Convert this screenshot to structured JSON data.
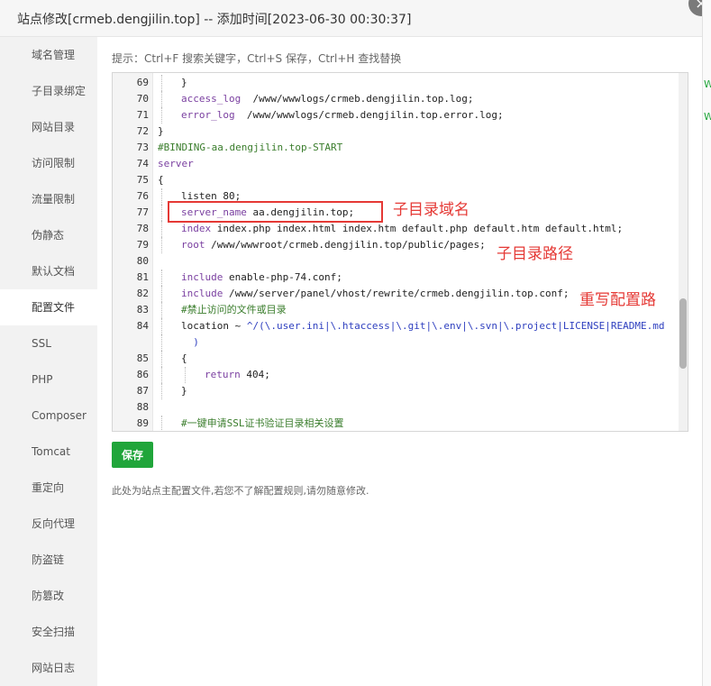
{
  "window": {
    "title": "站点修改[crmeb.dengjilin.top] -- 添加时间[2023-06-30 00:30:37]",
    "close_symbol": "×"
  },
  "sidebar": {
    "active_index": 7,
    "items": [
      "域名管理",
      "子目录绑定",
      "网站目录",
      "访问限制",
      "流量限制",
      "伪静态",
      "默认文档",
      "配置文件",
      "SSL",
      "PHP",
      "Composer",
      "Tomcat",
      "重定向",
      "反向代理",
      "防盗链",
      "防篡改",
      "安全扫描",
      "网站日志"
    ]
  },
  "hint": "提示：Ctrl+F 搜索关键字，Ctrl+S 保存，Ctrl+H 查找替换",
  "editor": {
    "lines": [
      {
        "ln": "69",
        "indent": 1,
        "segs": [
          {
            "t": "}",
            "c": "plain"
          }
        ]
      },
      {
        "ln": "70",
        "indent": 1,
        "segs": [
          {
            "t": "access_log",
            "c": "kw"
          },
          {
            "t": "  /www/wwwlogs/crmeb.dengjilin.top.log;",
            "c": "plain"
          }
        ]
      },
      {
        "ln": "71",
        "indent": 1,
        "segs": [
          {
            "t": "error_log",
            "c": "kw"
          },
          {
            "t": "  /www/wwwlogs/crmeb.dengjilin.top.error.log;",
            "c": "plain"
          }
        ]
      },
      {
        "ln": "72",
        "indent": 0,
        "segs": [
          {
            "t": "}",
            "c": "plain"
          }
        ]
      },
      {
        "ln": "73",
        "indent": 0,
        "segs": [
          {
            "t": "#BINDING-aa.dengjilin.top-START",
            "c": "green"
          }
        ]
      },
      {
        "ln": "74",
        "indent": 0,
        "segs": [
          {
            "t": "server",
            "c": "kw"
          }
        ]
      },
      {
        "ln": "75",
        "indent": 0,
        "segs": [
          {
            "t": "{",
            "c": "plain"
          }
        ]
      },
      {
        "ln": "76",
        "indent": 1,
        "segs": [
          {
            "t": "listen 80;",
            "c": "plain"
          }
        ]
      },
      {
        "ln": "77",
        "indent": 1,
        "segs": [
          {
            "t": "server_name",
            "c": "kw"
          },
          {
            "t": " aa.dengjilin.top;",
            "c": "plain"
          }
        ]
      },
      {
        "ln": "78",
        "indent": 1,
        "segs": [
          {
            "t": "index",
            "c": "kw"
          },
          {
            "t": " index.php index.html index.htm default.php default.htm default.html;",
            "c": "plain"
          }
        ]
      },
      {
        "ln": "79",
        "indent": 1,
        "segs": [
          {
            "t": "root",
            "c": "kw"
          },
          {
            "t": " /www/wwwroot/crmeb.dengjilin.top/public/pages;",
            "c": "plain"
          }
        ]
      },
      {
        "ln": "80",
        "indent": 0,
        "segs": []
      },
      {
        "ln": "81",
        "indent": 1,
        "segs": [
          {
            "t": "include",
            "c": "kw"
          },
          {
            "t": " enable-php-74.conf;",
            "c": "plain"
          }
        ]
      },
      {
        "ln": "82",
        "indent": 1,
        "segs": [
          {
            "t": "include",
            "c": "kw"
          },
          {
            "t": " /www/server/panel/vhost/rewrite/crmeb.dengjilin.top.conf;",
            "c": "plain"
          }
        ]
      },
      {
        "ln": "83",
        "indent": 1,
        "segs": [
          {
            "t": "#禁止访问的文件或目录",
            "c": "green"
          }
        ]
      },
      {
        "ln": "84",
        "indent": 1,
        "segs": [
          {
            "t": "location ~ ",
            "c": "plain"
          },
          {
            "t": "^/(\\.user.ini|\\.htaccess|\\.git|\\.env|\\.svn|\\.project|LICENSE|README.md",
            "c": "blue"
          }
        ]
      },
      {
        "ln": "",
        "indent": 1,
        "segs": [
          {
            "t": "  )",
            "c": "blue"
          }
        ]
      },
      {
        "ln": "85",
        "indent": 1,
        "segs": [
          {
            "t": "{",
            "c": "plain"
          }
        ]
      },
      {
        "ln": "86",
        "indent": 2,
        "segs": [
          {
            "t": "return",
            "c": "kw"
          },
          {
            "t": " 404;",
            "c": "plain"
          }
        ]
      },
      {
        "ln": "87",
        "indent": 1,
        "segs": [
          {
            "t": "}",
            "c": "plain"
          }
        ]
      },
      {
        "ln": "88",
        "indent": 0,
        "segs": []
      },
      {
        "ln": "89",
        "indent": 1,
        "segs": [
          {
            "t": "#一键申请SSL证书验证目录相关设置",
            "c": "green"
          }
        ]
      }
    ]
  },
  "annotations": {
    "subdomain": "子目录域名",
    "subpath": "子目录路径",
    "rewrite": "重写配置路"
  },
  "save_label": "保存",
  "footnote": "此处为站点主配置文件,若您不了解配置规则,请勿随意修改.",
  "colors": {
    "accent": "#20a53a",
    "annotation_red": "#e53935"
  },
  "background_glyphs": [
    "W",
    "W"
  ]
}
